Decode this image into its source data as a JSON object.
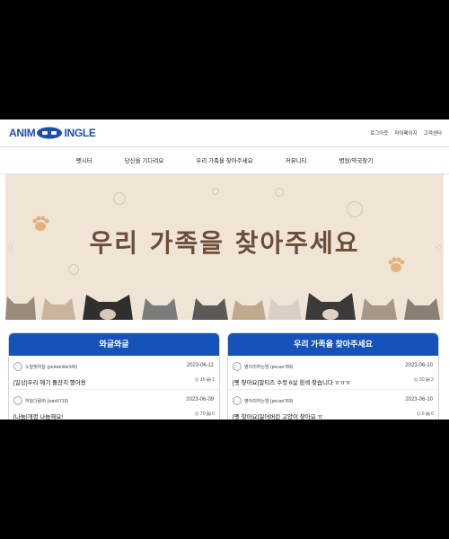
{
  "header": {
    "logo_left": "ANIM",
    "logo_right": "INGLE",
    "util_links": [
      "로그아웃",
      "마이페이지",
      "고객센터"
    ]
  },
  "nav": [
    "펫시터",
    "당신을 기다려요",
    "우리 가족을 찾아주세요",
    "커뮤니티",
    "병원/약국찾기"
  ],
  "banner": {
    "headline": "우리 가족을 찾아주세요",
    "prev": "‹",
    "next": "›",
    "bg_color": "#efe4d6",
    "text_color": "#6b4d3a"
  },
  "panels": [
    {
      "title": "와글와글",
      "posts": [
        {
          "author": "노을빛하늘 (periwinkle345)",
          "date": "2023-06-11",
          "title": "[일상]우리 애기 돌잔치 했어용",
          "views": "15",
          "comments": "1"
        },
        {
          "author": "하늘다람쥐 (wan5719)",
          "date": "2023-06-09",
          "title": "[나눔]개껌 나눔해요!",
          "views": "79",
          "comments": "0"
        }
      ]
    },
    {
      "title": "우리 가족을 찾아주세요",
      "posts": [
        {
          "author": "병아리하는밤 (pecan789)",
          "date": "2023-06-10",
          "title": "[펫 찾아요]말티즈 수컷 6살 흰색 찾습니다 ㅠㅠㅠ",
          "views": "30",
          "comments": "2"
        },
        {
          "author": "병아리하는밤 (pecan789)",
          "date": "2023-06-10",
          "title": "[펫 찾아요]잃어버린 고양이 찾아요 ㅠ",
          "views": "6",
          "comments": "0"
        }
      ]
    }
  ],
  "colors": {
    "brand": "#1553b8",
    "logo": "#1e4fa8"
  }
}
